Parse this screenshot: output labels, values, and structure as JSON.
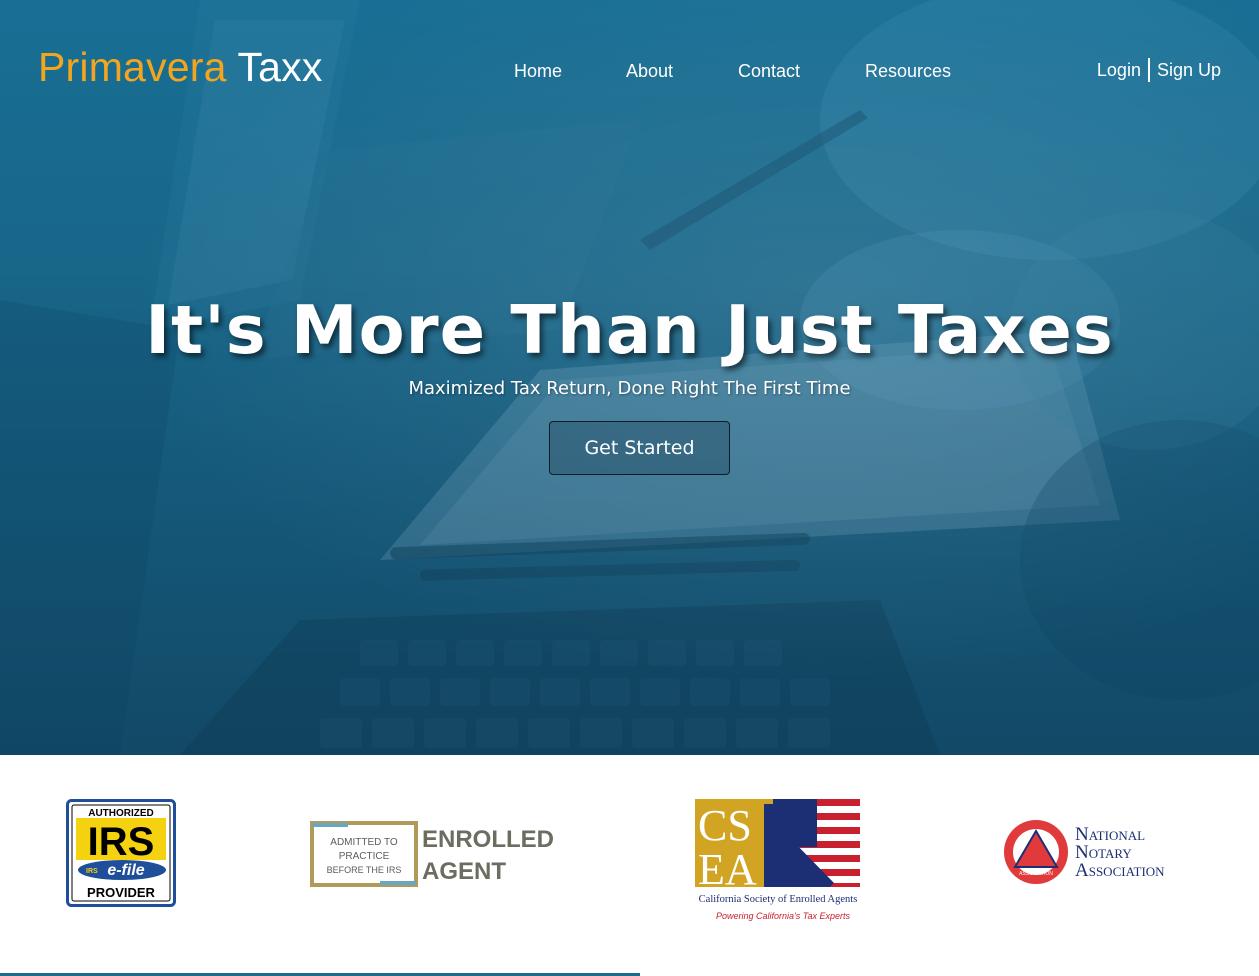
{
  "brand": {
    "name_part1": "Primavera",
    "name_part2": "Taxx"
  },
  "nav": {
    "items": [
      "Home",
      "About",
      "Contact",
      "Resources"
    ]
  },
  "auth": {
    "login": "Login",
    "signup": "Sign Up"
  },
  "hero": {
    "headline": "It's More Than Just Taxes",
    "subheadline": "Maximized Tax Return, Done Right The First Time",
    "cta": "Get Started"
  },
  "badges": {
    "irs": {
      "line1": "AUTHORIZED",
      "line2": "IRS",
      "line3": "e-file",
      "line3_prefix": "IRS",
      "line4": "PROVIDER"
    },
    "enrolled_agent": {
      "box_line1": "ADMITTED TO",
      "box_line2": "PRACTICE",
      "box_line3": "BEFORE THE IRS",
      "word1": "ENROLLED",
      "word2": "AGENT"
    },
    "csea": {
      "letters_top": "CS",
      "letters_bottom": "EA",
      "caption": "California Society of Enrolled Agents",
      "tagline": "Powering California's Tax Experts"
    },
    "nna": {
      "line1": "National",
      "line2": "Notary",
      "line3": "Association",
      "seal_text": "ASSOCIATION"
    }
  },
  "colors": {
    "brand_orange": "#f2a51d",
    "hero_blue": "#1b6a8c",
    "accent_line": "#1a6a8c"
  }
}
